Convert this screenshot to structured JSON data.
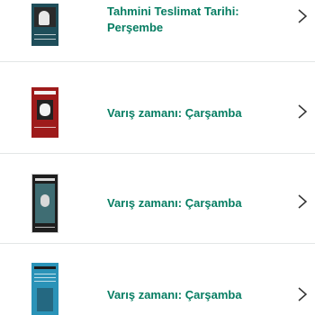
{
  "items": [
    {
      "line1": "Tahmini Teslimat Tarihi:",
      "line2": "Perşembe",
      "cover_colors": [
        "#1f4e5a",
        "#2b2b2b",
        "#e8e8e8"
      ],
      "icon": "chevron-right-icon"
    },
    {
      "line1": "Varış zamanı: Çarşamba",
      "cover_colors": [
        "#9e1b1b",
        "#f2f2f2",
        "#222222"
      ],
      "icon": "chevron-right-icon"
    },
    {
      "line1": "Varış zamanı: Çarşamba",
      "cover_colors": [
        "#1e1e1e",
        "#3f6d73",
        "#d9d9d9"
      ],
      "icon": "chevron-right-icon"
    },
    {
      "line1": "Varış zamanı: Çarşamba",
      "cover_colors": [
        "#2a93b8",
        "#ffffff",
        "#1b1b1b"
      ],
      "icon": "chevron-right-icon"
    }
  ],
  "colors": {
    "accent_text": "#067d62",
    "divider": "#e3e6e6",
    "chevron": "#333333"
  }
}
